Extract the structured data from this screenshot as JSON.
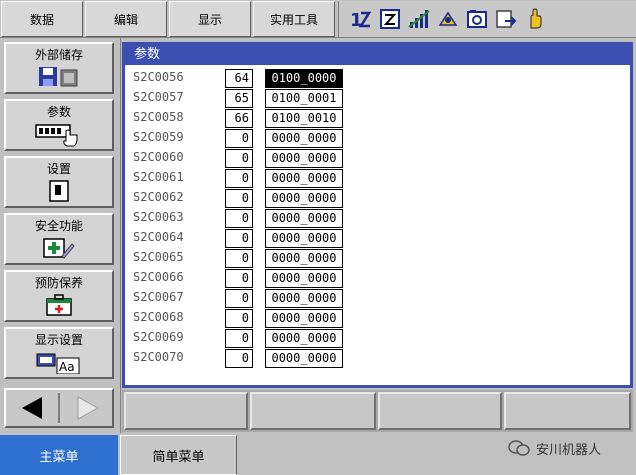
{
  "top_menu": {
    "data_label": "数据",
    "edit_label": "编辑",
    "display_label": "显示",
    "utility_label": "实用工具"
  },
  "left_menu": [
    {
      "label": "外部储存",
      "icon": "floppy-icon"
    },
    {
      "label": "参数",
      "icon": "parameter-icon"
    },
    {
      "label": "设置",
      "icon": "setup-icon"
    },
    {
      "label": "安全功能",
      "icon": "safety-icon"
    },
    {
      "label": "预防保养",
      "icon": "maintenance-icon"
    },
    {
      "label": "显示设置",
      "icon": "display-setting-icon"
    }
  ],
  "panel": {
    "title": "参数"
  },
  "params": [
    {
      "name": "S2C0056",
      "value": "64",
      "binary": "0100_0000",
      "selected": true
    },
    {
      "name": "S2C0057",
      "value": "65",
      "binary": "0100_0001"
    },
    {
      "name": "S2C0058",
      "value": "66",
      "binary": "0100_0010"
    },
    {
      "name": "S2C0059",
      "value": "0",
      "binary": "0000_0000"
    },
    {
      "name": "S2C0060",
      "value": "0",
      "binary": "0000_0000"
    },
    {
      "name": "S2C0061",
      "value": "0",
      "binary": "0000_0000"
    },
    {
      "name": "S2C0062",
      "value": "0",
      "binary": "0000_0000"
    },
    {
      "name": "S2C0063",
      "value": "0",
      "binary": "0000_0000"
    },
    {
      "name": "S2C0064",
      "value": "0",
      "binary": "0000_0000"
    },
    {
      "name": "S2C0065",
      "value": "0",
      "binary": "0000_0000"
    },
    {
      "name": "S2C0066",
      "value": "0",
      "binary": "0000_0000"
    },
    {
      "name": "S2C0067",
      "value": "0",
      "binary": "0000_0000"
    },
    {
      "name": "S2C0068",
      "value": "0",
      "binary": "0000_0000"
    },
    {
      "name": "S2C0069",
      "value": "0",
      "binary": "0000_0000"
    },
    {
      "name": "S2C0070",
      "value": "0",
      "binary": "0000_0000"
    }
  ],
  "bottom": {
    "main_menu_label": "主菜单",
    "simple_menu_label": "简单菜单",
    "watermark": "安川机器人"
  },
  "colors": {
    "accent": "#3a4fb0",
    "main_menu": "#2f6fd0"
  }
}
